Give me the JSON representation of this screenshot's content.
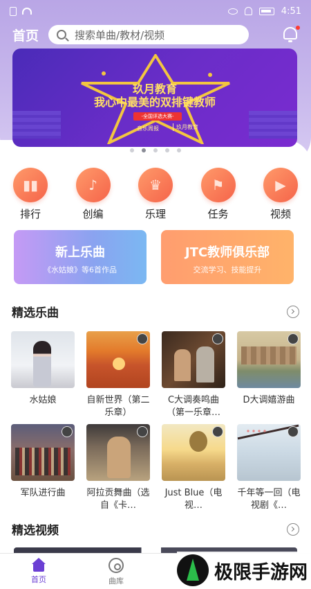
{
  "status_bar": {
    "time": "4:51"
  },
  "header": {
    "title": "首页",
    "search_placeholder": "搜索单曲/教材/视频"
  },
  "banner": {
    "brand": "玖月教育",
    "title": "我心中最美的双排键教师",
    "tag": "-全国评选大赛-",
    "sign": "音乐周报",
    "logo": "玖月教育",
    "page_count": 5,
    "active_index": 1
  },
  "categories": [
    {
      "label": "排行",
      "icon": "ranking-bars-icon",
      "glyph": "▮▮"
    },
    {
      "label": "创编",
      "icon": "music-note-icon",
      "glyph": "♪"
    },
    {
      "label": "乐理",
      "icon": "trophy-icon",
      "glyph": "♛"
    },
    {
      "label": "任务",
      "icon": "flag-icon",
      "glyph": "⚑"
    },
    {
      "label": "视频",
      "icon": "video-camera-icon",
      "glyph": "▶"
    }
  ],
  "promos": [
    {
      "title": "新上乐曲",
      "subtitle": "《水姑娘》等6首作品"
    },
    {
      "title": "JTC教师俱乐部",
      "subtitle": "交流学习、技能提升"
    }
  ],
  "featured_songs": {
    "title": "精选乐曲",
    "items": [
      {
        "label": "水姑娘"
      },
      {
        "label": "自新世界（第二乐章）"
      },
      {
        "label": "C大调奏鸣曲（第一乐章…"
      },
      {
        "label": "D大调嬉游曲"
      },
      {
        "label": "军队进行曲"
      },
      {
        "label": "阿拉贡舞曲（选自《卡…"
      },
      {
        "label": "Just Blue（电视…"
      },
      {
        "label": "千年等一回（电视剧《…"
      }
    ]
  },
  "featured_videos": {
    "title": "精选视频"
  },
  "bottom_nav": [
    {
      "label": "首页",
      "active": true
    },
    {
      "label": "曲库",
      "active": false
    }
  ],
  "watermark": {
    "text": "极限手游网"
  },
  "colors": {
    "accent": "#6b3fd4",
    "orange": "#f5644a",
    "header_purple": "#b9a6e6"
  }
}
